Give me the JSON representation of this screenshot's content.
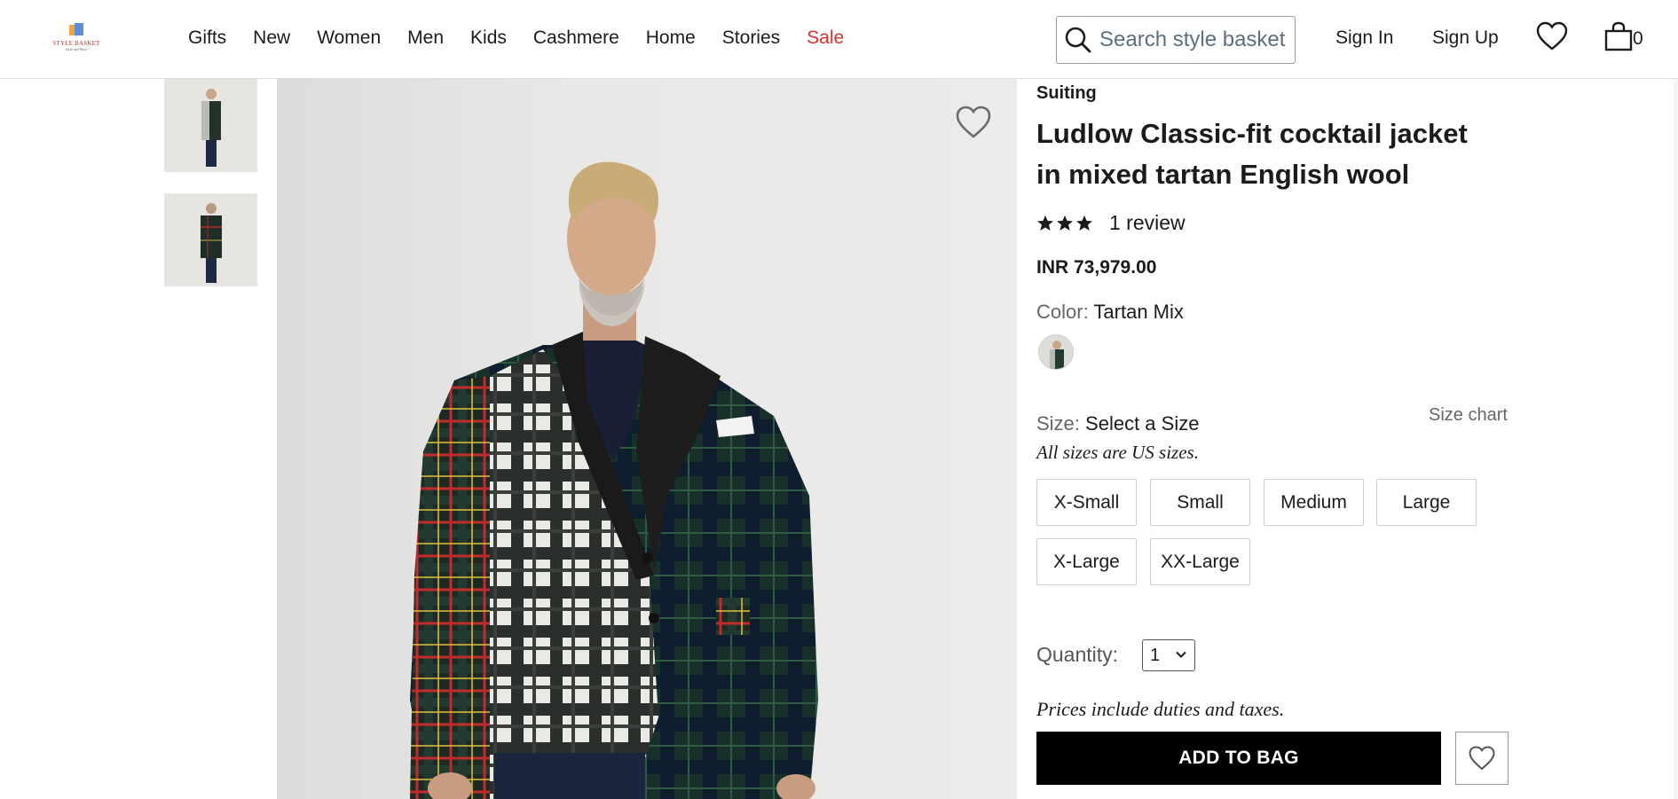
{
  "brand": {
    "logo_text": "STYLE BASKET",
    "logo_sub": "Style and More"
  },
  "nav": {
    "items": [
      {
        "label": "Gifts",
        "color": "#1b1b1b"
      },
      {
        "label": "New",
        "color": "#1b1b1b"
      },
      {
        "label": "Women",
        "color": "#1b1b1b"
      },
      {
        "label": "Men",
        "color": "#1b1b1b"
      },
      {
        "label": "Kids",
        "color": "#1b1b1b"
      },
      {
        "label": "Cashmere",
        "color": "#1b1b1b"
      },
      {
        "label": "Home",
        "color": "#1b1b1b"
      },
      {
        "label": "Stories",
        "color": "#1b1b1b"
      },
      {
        "label": "Sale",
        "color": "#d8322b"
      }
    ]
  },
  "search": {
    "placeholder": "Search style basket",
    "icon": "search-icon"
  },
  "header": {
    "sign_in": "Sign In",
    "sign_up": "Sign Up",
    "wishlist_icon": "heart-icon",
    "cart_icon": "shopping-bag-icon",
    "cart_count": "0"
  },
  "gallery": {
    "thumbnails": [
      "thumbnail-front",
      "thumbnail-back"
    ],
    "favorite_icon": "heart-outline-icon"
  },
  "product": {
    "category": "Suiting",
    "title": "Ludlow Classic-fit cocktail jacket in mixed tartan English wool",
    "rating": 3,
    "rating_max": 3,
    "review_text": "1 review",
    "price": "INR 73,979.00",
    "color_label": "Color:",
    "color_value": "Tartan Mix",
    "size_label": "Size:",
    "size_value": "Select a Size",
    "size_chart": "Size chart",
    "size_note": "All sizes are US sizes.",
    "sizes": [
      "X-Small",
      "Small",
      "Medium",
      "Large",
      "X-Large",
      "XX-Large"
    ],
    "quantity_label": "Quantity:",
    "quantity_value": "1",
    "duties_note": "Prices include duties and taxes.",
    "add_to_bag": "ADD TO BAG",
    "accent_color": "#000000"
  }
}
